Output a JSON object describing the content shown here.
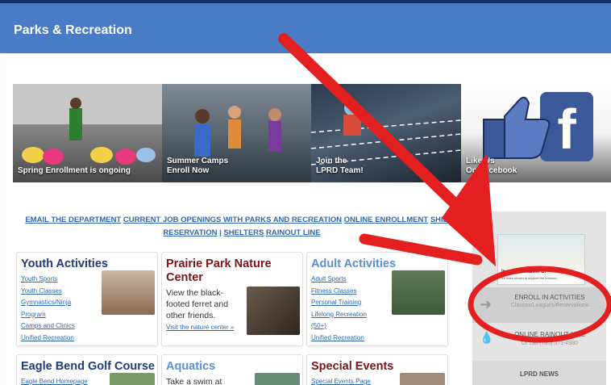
{
  "header": {
    "title": "Parks & Recreation"
  },
  "banners": [
    {
      "caption": "Spring Enrollment is ongoing"
    },
    {
      "caption": "Summer Camps\nEnroll Now"
    },
    {
      "caption": "Join the\nLPRD Team!"
    },
    {
      "caption": "Like Us\nOn Facebook"
    }
  ],
  "quick_links": {
    "email": "EMAIL THE DEPARTMENT",
    "jobs": "CURRENT JOB OPENINGS WITH PARKS AND RECREATION",
    "enrollment": "ONLINE ENROLLMENT",
    "shield_reservation": "SHIELD RESERVATION",
    "shelters": "SHELTERS",
    "rainout": "RAINOUT LINE",
    "separator": "|"
  },
  "cards": {
    "youth": {
      "title": "Youth Activities",
      "items": [
        "Youth Sports",
        "Youth Classes",
        "Gymnastics/Ninja",
        "Program",
        "Camps and Clinics",
        "Unified Recreation"
      ]
    },
    "prairie": {
      "title": "Prairie Park Nature Center",
      "desc": "View the black-footed ferret and other friends.",
      "link": "Visit the nature center »"
    },
    "adult": {
      "title": "Adult Activities",
      "items": [
        "Adult Sports",
        "Fitness Classes",
        "Personal Training",
        "Lifelong Recreation",
        "(50+)",
        "Unified Recreation"
      ]
    },
    "golf": {
      "title": "Eagle Bend Golf Course",
      "items": [
        "Eagle Bend Homepage"
      ]
    },
    "aquatics": {
      "title": "Aquatics",
      "desc": "Take a swim at"
    },
    "events": {
      "title": "Special Events",
      "items": [
        "Special Events Page"
      ]
    }
  },
  "sidebar": {
    "promo_title": "Increase Vitamin D.",
    "promo_sub": "It's been shown to support the immune",
    "enroll_title": "ENROLL IN ACTIVITIES",
    "enroll_sub": "Classes/Leagues/Reservations",
    "online_title": "ONLINE RAINOUT LINE",
    "online_sub": "Or call (785) 371-4980",
    "news": "LPRD NEWS"
  },
  "colors": {
    "header_bg": "#4a7cc6",
    "title_navy": "#1f3d7a",
    "title_blue": "#5a8fd0",
    "title_maroon": "#7b1515",
    "link_blue": "#2f68b0",
    "annotation_red": "#e41f1f"
  }
}
